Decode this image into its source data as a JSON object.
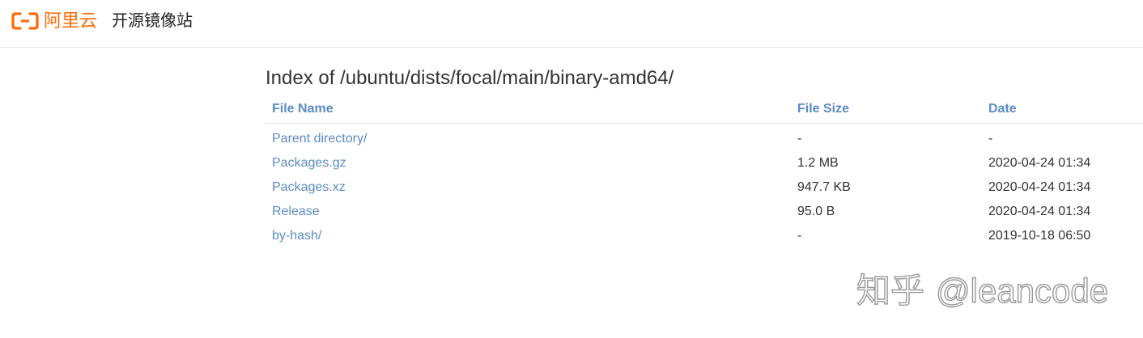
{
  "header": {
    "logo_text": "阿里云",
    "site_title": "开源镜像站",
    "brand_color": "#ff6a00"
  },
  "main": {
    "heading": "Index of /ubuntu/dists/focal/main/binary-amd64/",
    "columns": [
      "File Name",
      "File Size",
      "Date"
    ],
    "rows": [
      {
        "name": "Parent directory/",
        "size": "-",
        "date": "-"
      },
      {
        "name": "Packages.gz",
        "size": "1.2 MB",
        "date": "2020-04-24 01:34"
      },
      {
        "name": "Packages.xz",
        "size": "947.7 KB",
        "date": "2020-04-24 01:34"
      },
      {
        "name": "Release",
        "size": "95.0 B",
        "date": "2020-04-24 01:34"
      },
      {
        "name": "by-hash/",
        "size": "-",
        "date": "2019-10-18 06:50"
      }
    ],
    "link_color": "#5b8bc6"
  },
  "watermark": {
    "brand": "知乎",
    "handle": "@leancode"
  }
}
